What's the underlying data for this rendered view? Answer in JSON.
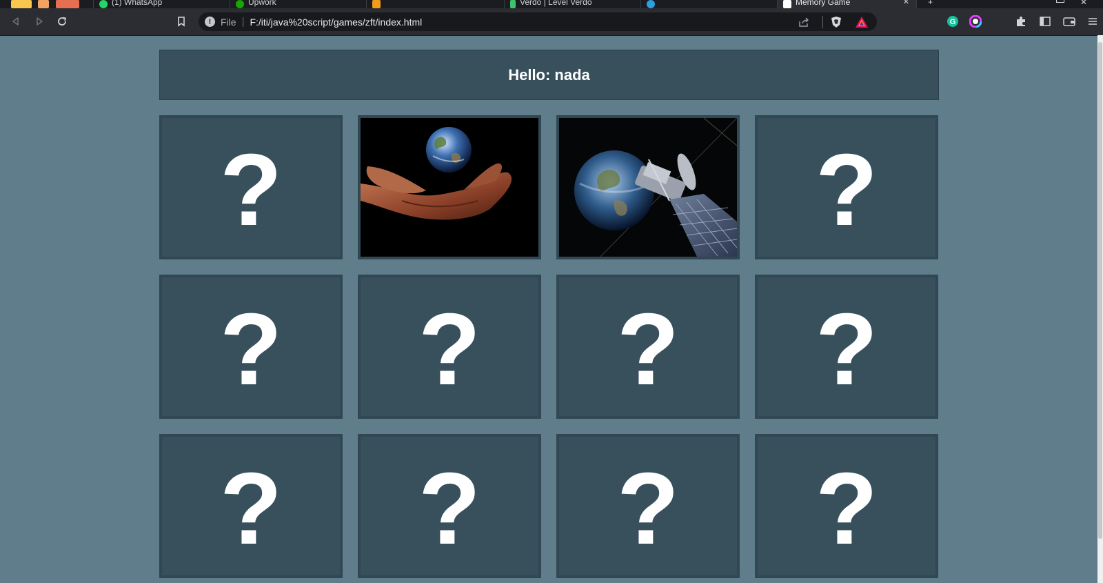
{
  "browser": {
    "tabs": [
      {
        "label": "(1) WhatsApp",
        "active": false
      },
      {
        "label": "Upwork",
        "active": false
      },
      {
        "label": "",
        "active": false
      },
      {
        "label": "Verdo | Level Verdo",
        "active": false
      },
      {
        "label": "",
        "active": false
      },
      {
        "label": "Memory Game",
        "active": true
      }
    ],
    "address": {
      "scheme": "File",
      "url": "F:/iti/java%20script/games/zft/index.html"
    },
    "colors": {
      "grammarly": "#15c39a",
      "brave": "#fb542b",
      "bat": "#e5155d"
    }
  },
  "page": {
    "greeting": "Hello: nada",
    "cards": [
      {
        "face": "?",
        "image": null
      },
      {
        "face": "",
        "image": "earth-in-hands"
      },
      {
        "face": "",
        "image": "satellite-over-earth"
      },
      {
        "face": "?",
        "image": null
      },
      {
        "face": "?",
        "image": null
      },
      {
        "face": "?",
        "image": null
      },
      {
        "face": "?",
        "image": null
      },
      {
        "face": "?",
        "image": null
      },
      {
        "face": "?",
        "image": null
      },
      {
        "face": "?",
        "image": null
      },
      {
        "face": "?",
        "image": null
      },
      {
        "face": "?",
        "image": null
      }
    ]
  },
  "colors": {
    "page_bg": "#607d8b",
    "card_bg": "#37505c",
    "text": "#ffffff"
  }
}
